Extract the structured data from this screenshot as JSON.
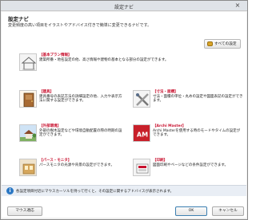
{
  "window": {
    "title": "設定ナビ",
    "close_label": "×"
  },
  "header": {
    "heading": "設定ナビ",
    "subheading": "変更頻度の高い項目をイラストやアドバイス付きで簡単に変更できるナビです。"
  },
  "all_settings": {
    "label": "すべての設定"
  },
  "cards": [
    {
      "title": "【基本プラン情報】",
      "desc": "建築所番・地名設定の他、高さ情報や建物の基本となる部分の設定ができます。",
      "icon": "house-outline-icon"
    },
    {
      "title": "【建具】",
      "desc": "建具番号の表記方法の詳細設定の他、入力や表示方法に関する設定ができます。",
      "icon": "door-icon"
    },
    {
      "title": "【寸法・面積】",
      "desc": "寸法・面積の単位・丸めの設定や図面表記の設定ができます。",
      "icon": "ruler-tools-icon"
    },
    {
      "title": "【外部環境】",
      "desc": "外部の樹木設定などや環境自動配置の際の時期の設定ができます。",
      "icon": "exterior-icon"
    },
    {
      "title": "【Archi Master】",
      "desc": "Archi Masterを使用する時のモードやタイムの設定ができます。",
      "icon": "am-logo-icon"
    },
    {
      "title": "【パース・モニタ】",
      "desc": "パースモニタの光源や背景の設定ができます。",
      "icon": "perspective-icon"
    },
    {
      "title": "【印刷】",
      "desc": "図面印刷やページなどの条件設定ができます。",
      "icon": "printer-icon"
    }
  ],
  "status": {
    "text": "各設定項目付近にマウスカーソルを持って行くと、その設定に関するアドバイスが表示されます。"
  },
  "buttons": {
    "mouse_settings": "マウス適応",
    "ok": "OK",
    "cancel": "キャンセル"
  }
}
